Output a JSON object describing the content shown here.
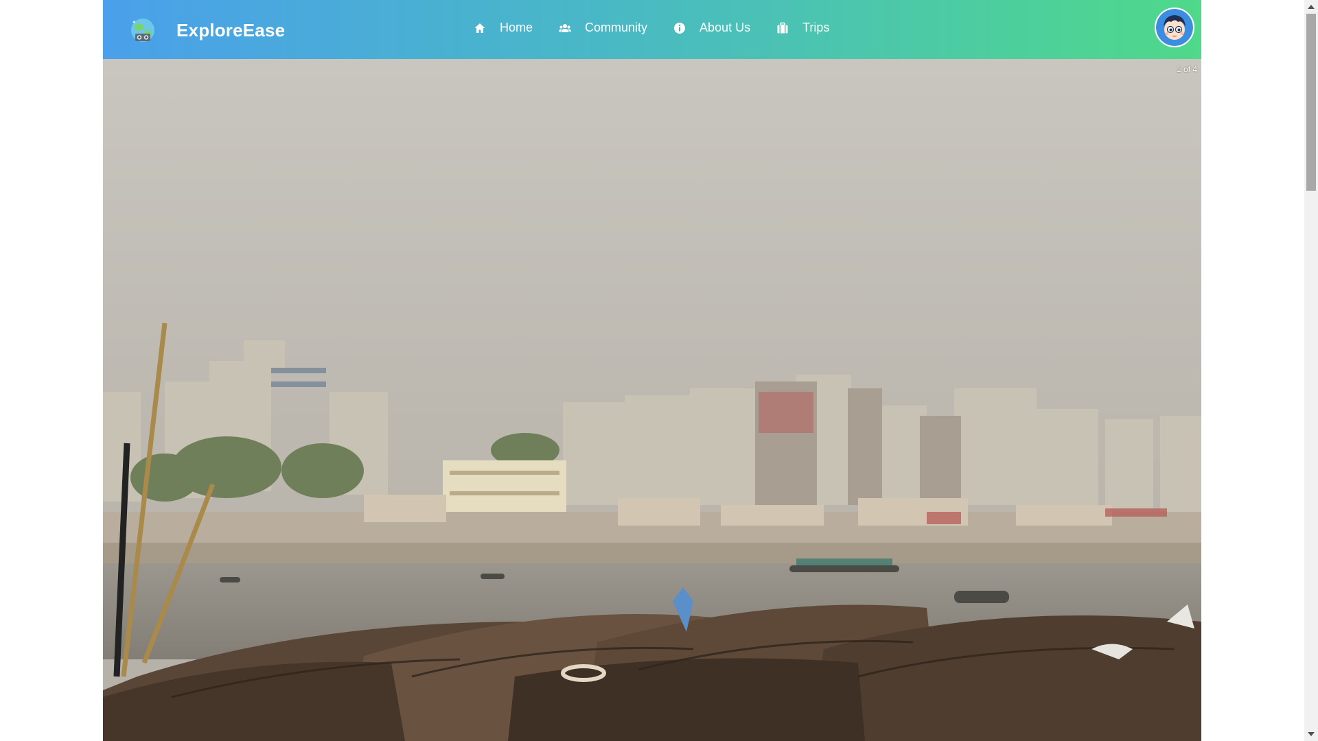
{
  "navbar": {
    "brand_name": "ExploreEase",
    "links": [
      {
        "label": "Home",
        "icon": "home-icon"
      },
      {
        "label": "Community",
        "icon": "users-icon"
      },
      {
        "label": "About Us",
        "icon": "info-icon"
      },
      {
        "label": "Trips",
        "icon": "briefcase-icon"
      }
    ],
    "gradient_colors": [
      "#4aa0ea",
      "#4fd98a"
    ]
  },
  "hero": {
    "slide_counter": "1 of 4",
    "image_subject": "photo of a riverside city with wooden boats"
  }
}
